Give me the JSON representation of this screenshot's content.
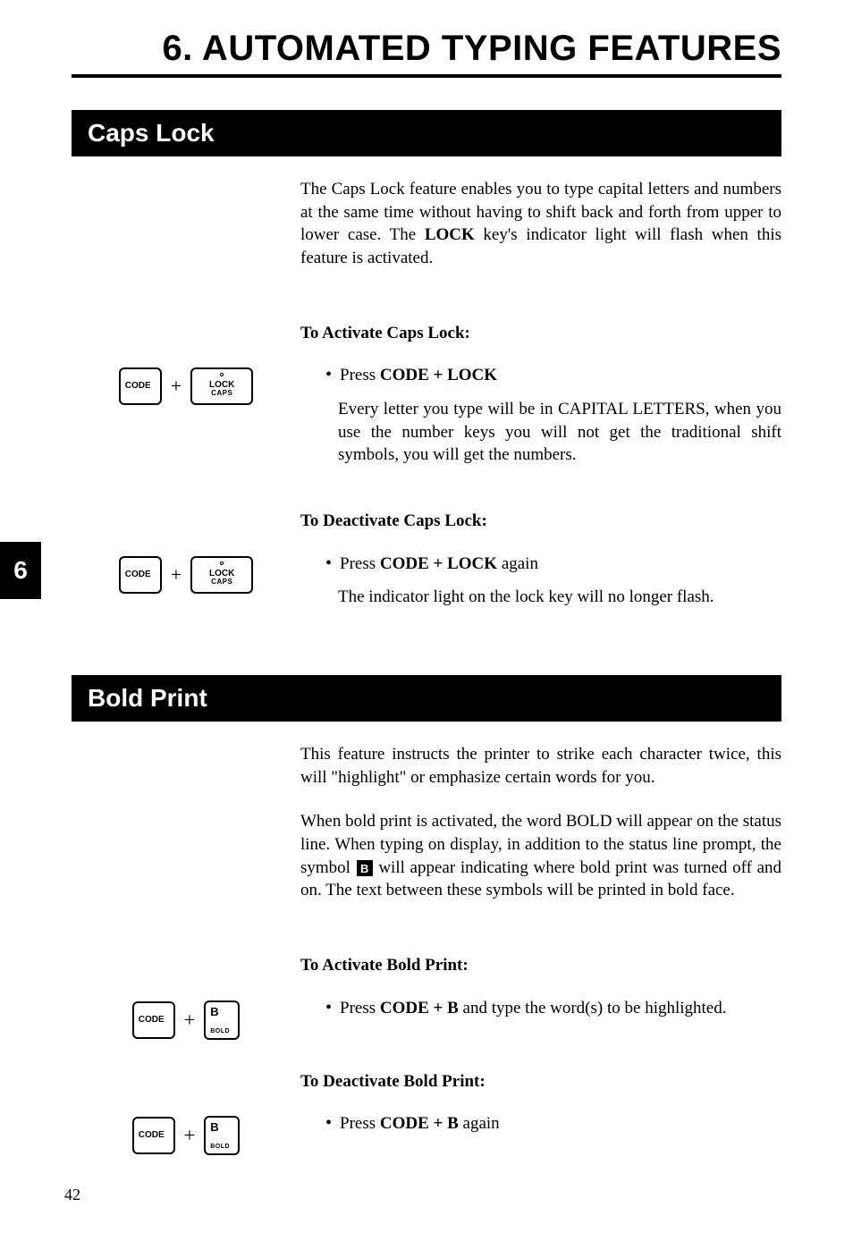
{
  "chapter": {
    "number": "6",
    "title": "6.  AUTOMATED TYPING FEATURES"
  },
  "page_number": "42",
  "keys": {
    "code": "CODE",
    "lock_top": "LOCK",
    "lock_bottom": "CAPS",
    "b_top": "B",
    "b_bottom": "BOLD",
    "plus": "+"
  },
  "inline": {
    "bold_symbol": "B"
  },
  "sections": [
    {
      "heading": "Caps Lock",
      "intro_segments": [
        {
          "t": "The Caps Lock feature enables you to type capital letters and numbers at the same time without having to shift back and forth from upper to lower case. The "
        },
        {
          "t": "LOCK",
          "bold": true
        },
        {
          "t": " key's indicator light will flash when this feature is activated."
        }
      ],
      "blocks": [
        {
          "sub_heading": "To Activate Caps Lock:",
          "key_combo": "code_lock",
          "bullet_segments": [
            {
              "t": "Press "
            },
            {
              "t": "CODE + LOCK",
              "bold": true
            }
          ],
          "follow": "Every letter you type will be in CAPITAL LETTERS, when you use the number keys you will not get the traditional shift symbols, you will get the numbers.",
          "follow_indent": true
        },
        {
          "sub_heading": "To Deactivate Caps Lock:",
          "key_combo": "code_lock",
          "bullet_segments": [
            {
              "t": "Press "
            },
            {
              "t": "CODE + LOCK",
              "bold": true
            },
            {
              "t": " again"
            }
          ],
          "follow": "The indicator light on the lock key will no longer flash.",
          "follow_indent": true
        }
      ]
    },
    {
      "heading": "Bold Print",
      "intro_segments": [
        {
          "t": "This feature instructs the printer to strike each character twice, this will \"highlight\" or emphasize certain words for you."
        }
      ],
      "intro2_segments": [
        {
          "t": "When bold print is activated, the word BOLD will appear on the status line. When typing on display, in addition to the status line prompt, the symbol "
        },
        {
          "chip": "inline.bold_symbol"
        },
        {
          "t": " will appear indicating where bold print was turned off and on. The text between these symbols will be printed in bold face."
        }
      ],
      "blocks": [
        {
          "sub_heading": "To Activate Bold Print:",
          "key_combo": "code_b",
          "bullet_segments": [
            {
              "t": "Press "
            },
            {
              "t": "CODE + B",
              "bold": true
            },
            {
              "t": " and type the word(s) to be highlighted."
            }
          ]
        },
        {
          "sub_heading": "To Deactivate Bold Print:",
          "key_combo": "code_b",
          "bullet_segments": [
            {
              "t": "Press "
            },
            {
              "t": "CODE + B",
              "bold": true
            },
            {
              "t": " again"
            }
          ]
        }
      ]
    }
  ]
}
